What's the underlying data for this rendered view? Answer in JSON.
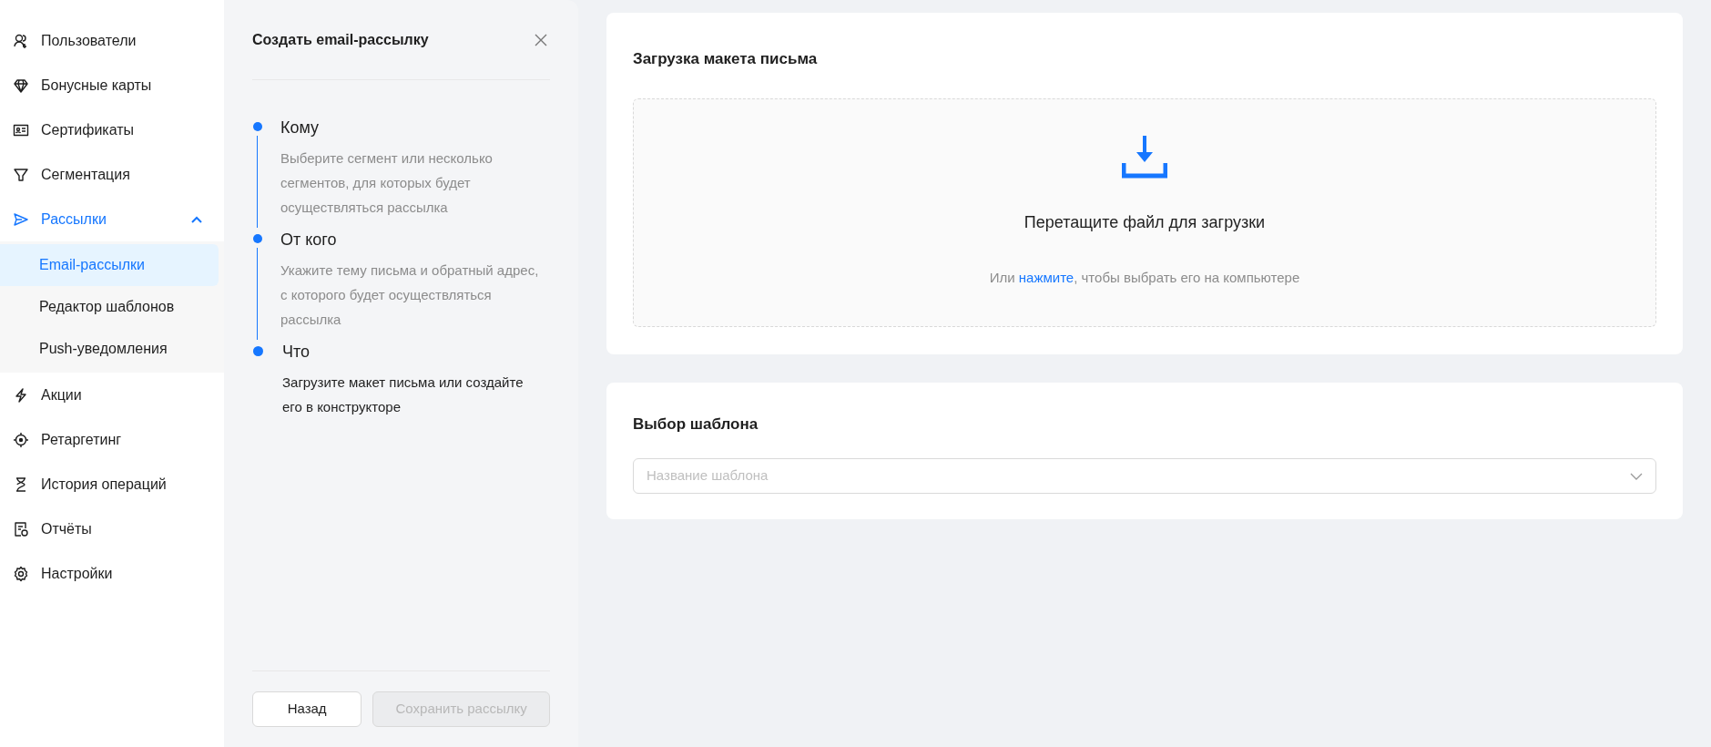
{
  "sidebar": {
    "items": [
      {
        "label": "Пользователи",
        "selected": false
      },
      {
        "label": "Бонусные карты",
        "selected": false
      },
      {
        "label": "Сертификаты",
        "selected": false
      },
      {
        "label": "Сегментация",
        "selected": false
      },
      {
        "label": "Рассылки",
        "selected": true,
        "expanded": true,
        "children": [
          {
            "label": "Email-рассылки",
            "selected": true
          },
          {
            "label": "Редактор шаблонов",
            "selected": false
          },
          {
            "label": "Push-уведомления",
            "selected": false
          }
        ]
      },
      {
        "label": "Акции",
        "selected": false
      },
      {
        "label": "Ретаргетинг",
        "selected": false
      },
      {
        "label": "История операций",
        "selected": false
      },
      {
        "label": "Отчёты",
        "selected": false
      },
      {
        "label": "Настройки",
        "selected": false
      }
    ]
  },
  "wizard": {
    "title": "Создать email-рассылку",
    "steps": [
      {
        "title": "Кому",
        "description": "Выберите сегмент или несколько сегментов, для которых будет осуществляться рассылка",
        "current": false
      },
      {
        "title": "От кого",
        "description": "Укажите тему письма и обратный адрес, с которого будет осуществляться рассылка",
        "current": false
      },
      {
        "title": "Что",
        "description": "Загрузите макет письма или создайте его в конструкторе",
        "current": true
      }
    ],
    "buttons": [
      {
        "label": "Назад",
        "disabled": false
      },
      {
        "label": "Сохранить рассылку",
        "disabled": true
      }
    ]
  },
  "upload": {
    "title": "Загрузка макета письма",
    "prompt": "Перетащите файл для загрузки",
    "hint_before": "Или ",
    "hint_link": "нажмите",
    "hint_after": ", чтобы выбрать его на компьютере"
  },
  "template": {
    "title": "Выбор шаблона",
    "placeholder": "Название шаблона"
  }
}
